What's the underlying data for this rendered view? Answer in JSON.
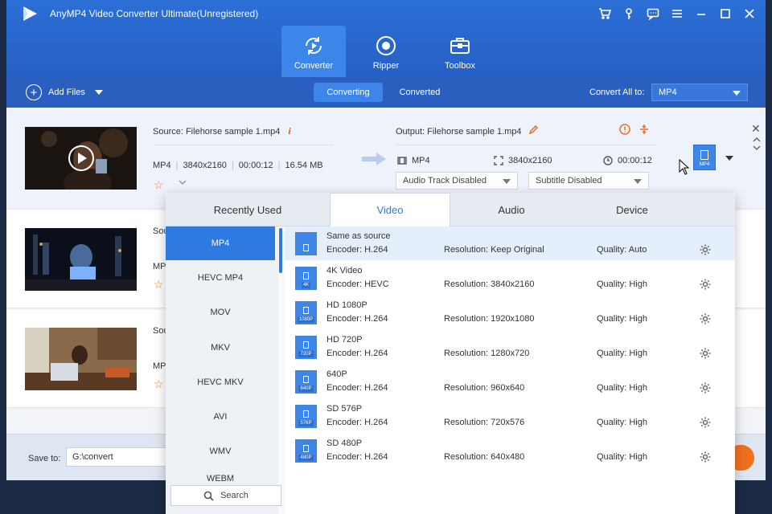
{
  "window": {
    "title": "AnyMP4 Video Converter Ultimate(Unregistered)",
    "controls": [
      "cart-icon",
      "key-icon",
      "feedback-icon",
      "menu-icon",
      "minimize-icon",
      "maximize-icon",
      "close-icon"
    ]
  },
  "nav": {
    "tabs": [
      {
        "label": "Converter",
        "icon": "converter-icon",
        "active": true
      },
      {
        "label": "Ripper",
        "icon": "ripper-icon",
        "active": false
      },
      {
        "label": "Toolbox",
        "icon": "toolbox-icon",
        "active": false
      }
    ]
  },
  "toolbar": {
    "add_files": "Add Files",
    "tab_converting": "Converting",
    "tab_converted": "Converted",
    "convert_all_label": "Convert All to:",
    "convert_all_value": "MP4"
  },
  "files": [
    {
      "source": "Source: Filehorse sample 1.mp4",
      "format": "MP4",
      "resolution": "3840x2160",
      "duration": "00:00:12",
      "size": "16.54 MB",
      "output": "Output: Filehorse sample 1.mp4",
      "out_format": "MP4",
      "out_resolution": "3840x2160",
      "out_duration": "00:00:12",
      "audio_track": "Audio Track Disabled",
      "subtitle": "Subtitle Disabled",
      "format_tile": "MP4"
    },
    {
      "source_partial": "Sou",
      "format_partial": "MP"
    },
    {
      "source_partial": "Sou",
      "format_partial": "MP"
    }
  ],
  "bottom": {
    "save_label": "Save to:",
    "save_path": "G:\\convert"
  },
  "popup": {
    "tabs": [
      "Recently Used",
      "Video",
      "Audio",
      "Device"
    ],
    "active_tab": "Video",
    "categories": [
      "MP4",
      "HEVC MP4",
      "MOV",
      "MKV",
      "HEVC MKV",
      "AVI",
      "WMV",
      "WEBM"
    ],
    "active_category": "MP4",
    "search": "Search",
    "presets": [
      {
        "name": "Same as source",
        "encoder": "Encoder: H.264",
        "resolution": "Resolution: Keep Original",
        "quality": "Quality: Auto",
        "tag": ""
      },
      {
        "name": "4K Video",
        "encoder": "Encoder: HEVC",
        "resolution": "Resolution: 3840x2160",
        "quality": "Quality: High",
        "tag": "4K"
      },
      {
        "name": "HD 1080P",
        "encoder": "Encoder: H.264",
        "resolution": "Resolution: 1920x1080",
        "quality": "Quality: High",
        "tag": "1080P"
      },
      {
        "name": "HD 720P",
        "encoder": "Encoder: H.264",
        "resolution": "Resolution: 1280x720",
        "quality": "Quality: High",
        "tag": "720P"
      },
      {
        "name": "640P",
        "encoder": "Encoder: H.264",
        "resolution": "Resolution: 960x640",
        "quality": "Quality: High",
        "tag": "640P"
      },
      {
        "name": "SD 576P",
        "encoder": "Encoder: H.264",
        "resolution": "Resolution: 720x576",
        "quality": "Quality: High",
        "tag": "576P"
      },
      {
        "name": "SD 480P",
        "encoder": "Encoder: H.264",
        "resolution": "Resolution: 640x480",
        "quality": "Quality: High",
        "tag": "480P"
      }
    ]
  },
  "colors": {
    "accent": "#2f7ae0",
    "title_bar": "#2b6fd6",
    "convert_button": "#f07020",
    "warning": "#e0702a"
  }
}
